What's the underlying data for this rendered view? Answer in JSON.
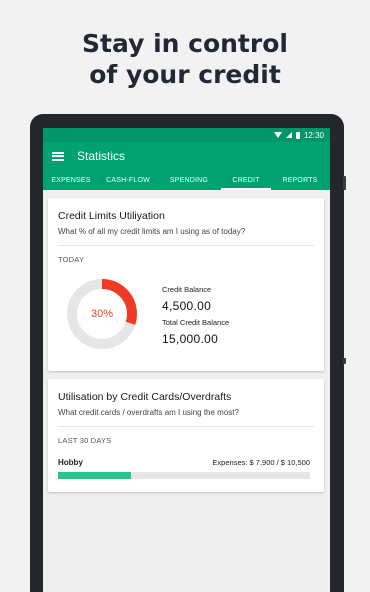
{
  "headline": {
    "line1": "Stay in control",
    "line2": "of your credit"
  },
  "status_bar": {
    "time": "12:30"
  },
  "app_bar": {
    "title": "Statistics"
  },
  "tabs": [
    {
      "label": "EXPENSES",
      "active": false
    },
    {
      "label": "CASH-FLOW",
      "active": false
    },
    {
      "label": "SPENDING",
      "active": false
    },
    {
      "label": "CREDIT",
      "active": true
    },
    {
      "label": "REPORTS",
      "active": false
    }
  ],
  "credit_limits_card": {
    "title": "Credit Limits Utiliyation",
    "subtitle": "What % of all my credit limits am I using as of today?",
    "period": "TODAY",
    "utilization_percent_label": "30%",
    "utilization_fraction": 0.3,
    "credit_balance_label": "Credit Balance",
    "credit_balance_value": "4,500.00",
    "total_credit_balance_label": "Total Credit Balance",
    "total_credit_balance_value": "15,000.00",
    "colors": {
      "used": "#ef3b26",
      "remaining": "#e6e6e6"
    }
  },
  "utilisation_card": {
    "title": "Utilisation by Credit Cards/Overdrafts",
    "subtitle": "What credit cards / overdrafts am I using the most?",
    "period": "LAST 30 DAYS",
    "items": [
      {
        "name": "Hobby",
        "amount": "Expenses: $ 7,900 / $ 10,500",
        "fraction": 0.29
      }
    ],
    "colors": {
      "fill": "#2bc48a"
    }
  }
}
